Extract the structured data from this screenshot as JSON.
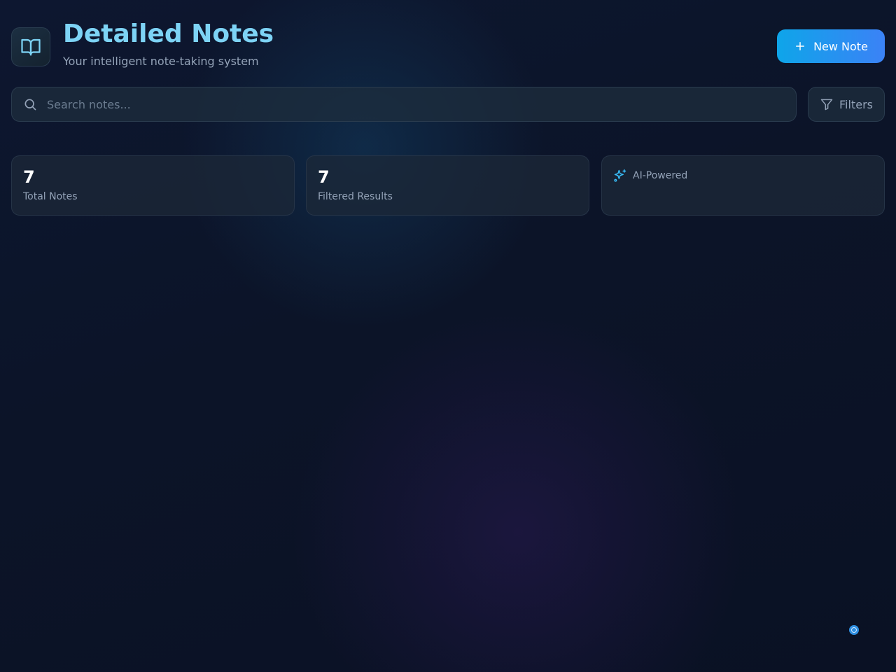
{
  "header": {
    "title": "Detailed Notes",
    "subtitle": "Your intelligent note-taking system",
    "logo_icon": "book-open-icon"
  },
  "toolbar": {
    "new_note_label": "New Note"
  },
  "search": {
    "placeholder": "Search notes...",
    "value": ""
  },
  "filters": {
    "label": "Filters"
  },
  "stats": {
    "total_notes": {
      "value": "7",
      "label": "Total Notes"
    },
    "filtered_results": {
      "value": "7",
      "label": "Filtered Results"
    },
    "ai": {
      "label": "AI-Powered",
      "icon": "sparkles-icon"
    }
  },
  "colors": {
    "accent": "#7dd3f5",
    "button_start": "#0ea5e9",
    "button_end": "#3b82f6",
    "background": "#0c1428"
  }
}
